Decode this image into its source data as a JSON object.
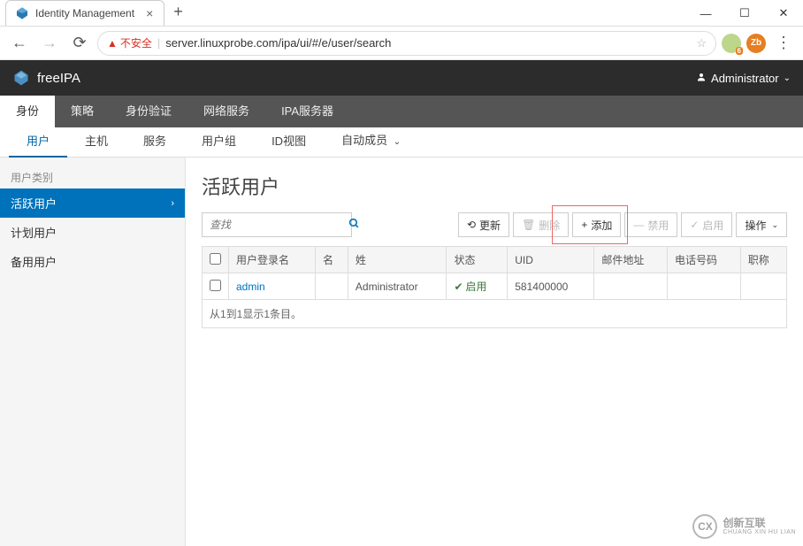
{
  "browser": {
    "tab_title": "Identity Management",
    "url": "server.linuxprobe.com/ipa/ui/#/e/user/search",
    "security_label": "不安全"
  },
  "app": {
    "brand": "freeIPA",
    "user": "Administrator"
  },
  "main_nav": [
    "身份",
    "策略",
    "身份验证",
    "网络服务",
    "IPA服务器"
  ],
  "sub_nav": [
    "用户",
    "主机",
    "服务",
    "用户组",
    "ID视图",
    "自动成员"
  ],
  "sidebar": {
    "category": "用户类别",
    "items": [
      "活跃用户",
      "计划用户",
      "备用用户"
    ]
  },
  "page": {
    "title": "活跃用户",
    "search_placeholder": "查找"
  },
  "actions": {
    "refresh": "更新",
    "delete": "删除",
    "add": "添加",
    "disable": "禁用",
    "enable": "启用",
    "operate": "操作"
  },
  "table": {
    "headers": {
      "login": "用户登录名",
      "first": "名",
      "last": "姓",
      "status": "状态",
      "uid": "UID",
      "email": "邮件地址",
      "phone": "电话号码",
      "title": "职称"
    },
    "rows": [
      {
        "login": "admin",
        "first": "",
        "last": "Administrator",
        "status": "启用",
        "uid": "581400000",
        "email": "",
        "phone": "",
        "title": ""
      }
    ],
    "footer": "从1到1显示1条目。"
  },
  "watermark": {
    "logo": "CX",
    "line1": "创新互联",
    "line2": "CHUANG XIN HU LIAN"
  }
}
